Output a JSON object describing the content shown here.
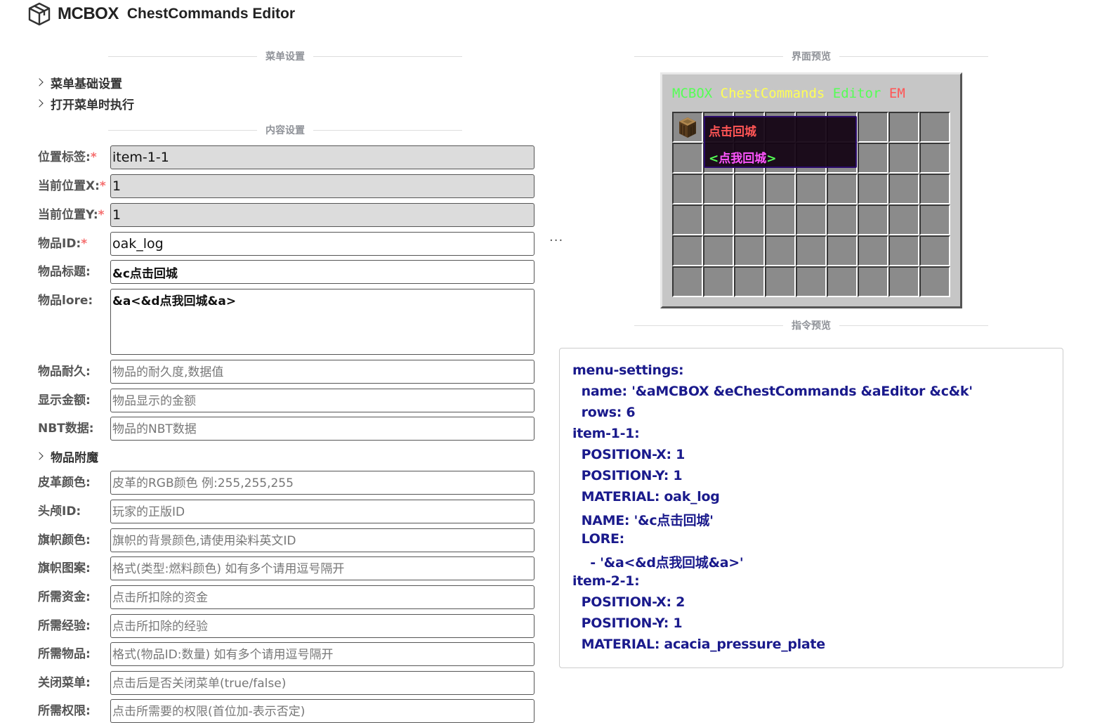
{
  "header": {
    "brand": "MCBOX",
    "subtitle": "ChestCommands Editor",
    "logo_icon": "cube-icon"
  },
  "left": {
    "section_menu": "菜单设置",
    "collapse_basic": "菜单基础设置",
    "collapse_open": "打开菜单时执行",
    "section_content": "内容设置",
    "fields": {
      "tag": {
        "label": "位置标签:",
        "req": "*",
        "value": "item-1-1"
      },
      "pos_x": {
        "label": "当前位置X:",
        "req": "*",
        "value": "1"
      },
      "pos_y": {
        "label": "当前位置Y:",
        "req": "*",
        "value": "1"
      },
      "item_id": {
        "label": "物品ID:",
        "req": "*",
        "value": "oak_log",
        "more": "···"
      },
      "title": {
        "label": "物品标题:",
        "value": "&c点击回城"
      },
      "lore": {
        "label": "物品lore:",
        "value": "&a<&d点我回城&a>"
      },
      "durability": {
        "label": "物品耐久:",
        "placeholder": "物品的耐久度,数据值"
      },
      "price": {
        "label": "显示金额:",
        "placeholder": "物品显示的金额"
      },
      "nbt": {
        "label": "NBT数据:",
        "placeholder": "物品的NBT数据"
      },
      "leather": {
        "label": "皮革颜色:",
        "placeholder": "皮革的RGB颜色 例:255,255,255"
      },
      "skull": {
        "label": "头颅ID:",
        "placeholder": "玩家的正版ID"
      },
      "banner_color": {
        "label": "旗帜颜色:",
        "placeholder": "旗帜的背景颜色,请使用染料英文ID"
      },
      "banner_pattern": {
        "label": "旗帜图案:",
        "placeholder": "格式(类型:燃料颜色) 如有多个请用逗号隔开"
      },
      "money": {
        "label": "所需资金:",
        "placeholder": "点击所扣除的资金"
      },
      "exp": {
        "label": "所需经验:",
        "placeholder": "点击所扣除的经验"
      },
      "items": {
        "label": "所需物品:",
        "placeholder": "格式(物品ID:数量) 如有多个请用逗号隔开"
      },
      "close": {
        "label": "关闭菜单:",
        "placeholder": "点击后是否关闭菜单(true/false)"
      },
      "perm": {
        "label": "所需权限:",
        "placeholder": "点击所需要的权限(首位加-表示否定)"
      }
    },
    "collapse_enchant": "物品附魔"
  },
  "right": {
    "section_preview": "界面预览",
    "section_command": "指令预览",
    "mc_title": {
      "a": "MCBOX ",
      "b": "ChestCommands ",
      "c": "Editor ",
      "d": "EM"
    },
    "tooltip": {
      "name": "点击回城",
      "lore_l": "<",
      "lore_mid": "点我回城",
      "lore_r": ">"
    },
    "grid": {
      "rows": 6,
      "cols": 9
    },
    "colors": {
      "green": "#55ff55",
      "yellow": "#ffff55",
      "red": "#ff5555",
      "pink": "#ff55ff"
    },
    "code": [
      "menu-settings:",
      "  name: '&aMCBOX &eChestCommands &aEditor &c&k'",
      "  rows: 6",
      "item-1-1:",
      "  POSITION-X: 1",
      "  POSITION-Y: 1",
      "  MATERIAL: oak_log",
      "  NAME: '&c点击回城'",
      "  LORE:",
      "    - '&a<&d点我回城&a>'",
      "item-2-1:",
      "  POSITION-X: 2",
      "  POSITION-Y: 1",
      "  MATERIAL: acacia_pressure_plate"
    ]
  }
}
